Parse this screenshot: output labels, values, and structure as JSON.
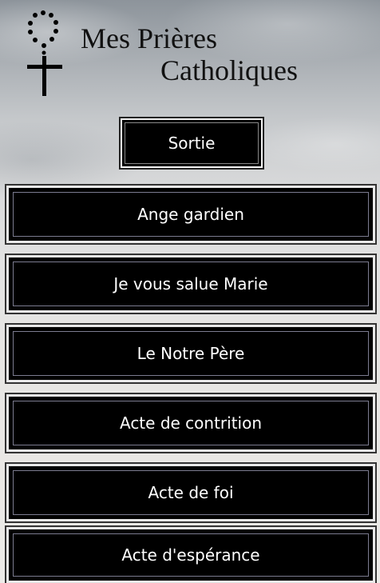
{
  "header": {
    "title_line1": "Mes Prières",
    "title_line2": "Catholiques",
    "logo_icon": "rosary-cross-icon"
  },
  "exit_button": {
    "label": "Sortie"
  },
  "prayers": [
    {
      "label": "Ange gardien"
    },
    {
      "label": "Je vous salue Marie"
    },
    {
      "label": "Le Notre Père"
    },
    {
      "label": "Acte de contrition"
    },
    {
      "label": "Acte de foi"
    },
    {
      "label": "Acte d'espérance"
    }
  ]
}
